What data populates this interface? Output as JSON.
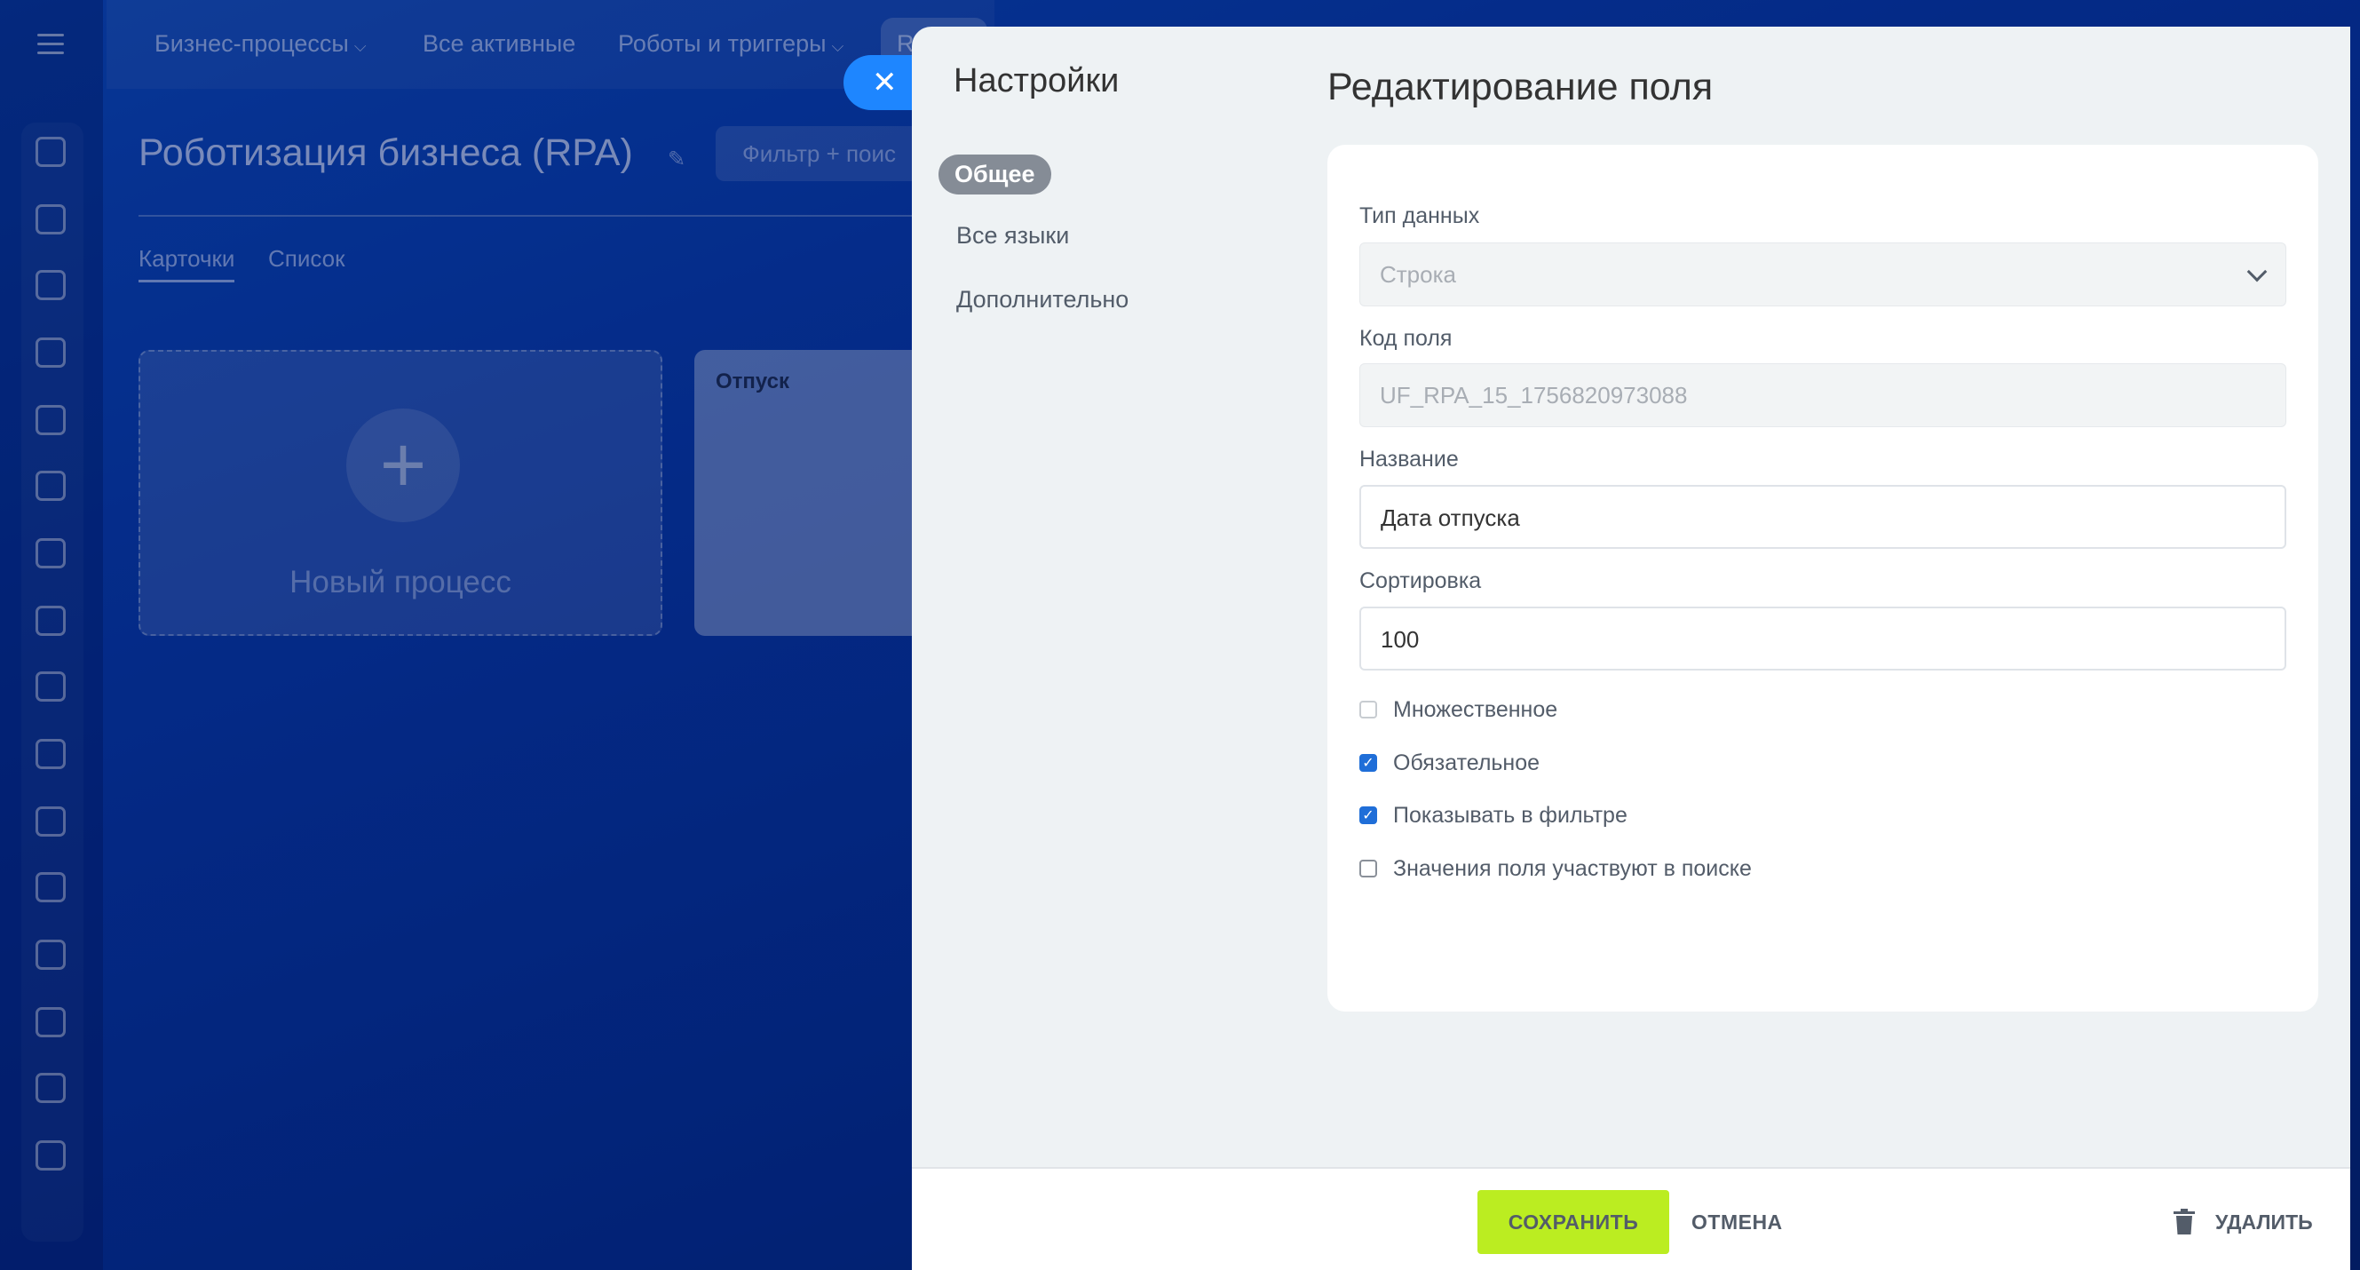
{
  "background": {
    "top_menu": [
      {
        "label": "Бизнес-процессы",
        "chevron": true
      },
      {
        "label": "Все активные",
        "chevron": false
      },
      {
        "label": "Роботы и триггеры",
        "chevron": true
      },
      {
        "label": "R",
        "chevron": false
      }
    ],
    "page_title": "Роботизация бизнеса (RPA)",
    "filter_placeholder": "Фильтр + поис",
    "view_tabs": [
      "Карточки",
      "Список"
    ],
    "new_process_label": "Новый процесс",
    "process_card_title": "Отпуск"
  },
  "panel": {
    "nav_title": "Настройки",
    "nav_items": [
      {
        "label": "Общее",
        "active": true
      },
      {
        "label": "Все языки",
        "active": false
      },
      {
        "label": "Дополнительно",
        "active": false
      }
    ],
    "main_title": "Редактирование поля",
    "form": {
      "data_type": {
        "label": "Тип данных",
        "value": "Строка"
      },
      "field_code": {
        "label": "Код поля",
        "value": "UF_RPA_15_1756820973088"
      },
      "name": {
        "label": "Название",
        "value": "Дата отпуска"
      },
      "sort": {
        "label": "Сортировка",
        "value": "100"
      },
      "checkboxes": [
        {
          "label": "Множественное",
          "checked": false,
          "disabled": true
        },
        {
          "label": "Обязательное",
          "checked": true,
          "disabled": false
        },
        {
          "label": "Показывать в фильтре",
          "checked": true,
          "disabled": false
        },
        {
          "label": "Значения поля участвуют в поиске",
          "checked": false,
          "disabled": false
        }
      ]
    },
    "footer": {
      "save_label": "СОХРАНИТЬ",
      "cancel_label": "ОТМЕНА",
      "delete_label": "УДАЛИТЬ"
    }
  },
  "colors": {
    "accent_green": "#bbed21",
    "checkbox_blue": "#1f6ed8",
    "close_blue": "#1e86ff"
  }
}
